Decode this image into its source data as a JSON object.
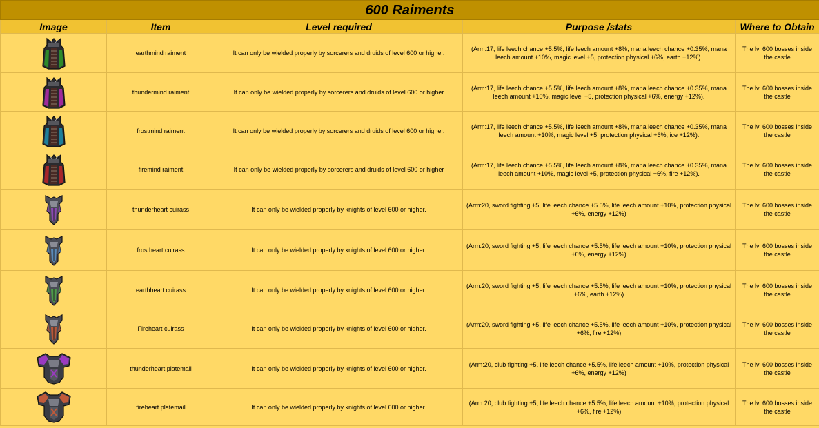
{
  "title": "600 Raiments",
  "headers": {
    "image": "Image",
    "item": "Item",
    "level": "Level required",
    "purpose": "Purpose /stats",
    "where": "Where to Obtain"
  },
  "rows": [
    {
      "icon": "earthmind-raiment-icon",
      "shape": "robe",
      "color": "#2f8a2a",
      "item": "earthmind raiment",
      "level": "It can only be wielded properly by sorcerers and druids of level 600 or higher.",
      "purpose": "(Arm:17, life leech chance +5.5%, life leech amount +8%, mana leech chance +0.35%, mana leech amount +10%, magic level +5, protection physical +6%, earth +12%).",
      "where": "The lvl 600 bosses inside the castle"
    },
    {
      "icon": "thundermind-raiment-icon",
      "shape": "robe",
      "color": "#a02a9a",
      "item": "thundermind raiment",
      "level": "It can only be wielded properly by sorcerers and druids of level 600 or higher",
      "purpose": "(Arm:17, life leech chance +5.5%, life leech amount +8%, mana leech chance +0.35%, mana leech amount +10%, magic level +5, protection physical +6%, energy +12%).",
      "where": "The lvl 600 bosses inside the castle"
    },
    {
      "icon": "frostmind-raiment-icon",
      "shape": "robe",
      "color": "#1f7f9a",
      "item": "frostmind raiment",
      "level": "It can only be wielded properly by sorcerers and druids of level 600 or higher.",
      "purpose": "(Arm:17, life leech chance +5.5%, life leech amount +8%, mana leech chance +0.35%, mana leech amount +10%, magic level +5, protection physical +6%, ice +12%).",
      "where": "The lvl 600 bosses inside the castle"
    },
    {
      "icon": "firemind-raiment-icon",
      "shape": "robe",
      "color": "#a8262a",
      "item": "firemind raiment",
      "level": "It can only be wielded properly by sorcerers and druids of level 600 or higher",
      "purpose": "(Arm:17, life leech chance +5.5%, life leech amount +8%, mana leech chance +0.35%, mana leech amount +10%, magic level +5, protection physical +6%, fire +12%).",
      "where": "The lvl 600 bosses inside the castle"
    },
    {
      "icon": "thunderheart-cuirass-icon",
      "shape": "cuirass",
      "color": "#8a4ab0",
      "item": "thunderheart cuirass",
      "level": "It can only be wielded properly by knights of level 600 or higher.",
      "purpose": "(Arm:20, sword fighting +5, life leech chance +5.5%, life leech amount +10%, protection physical +6%, energy +12%)",
      "where": "The lvl 600 bosses inside the castle"
    },
    {
      "icon": "frostheart-cuirass-icon",
      "shape": "cuirass",
      "color": "#5a8ab8",
      "item": "frostheart cuirass",
      "level": "It can only be wielded properly by knights of level 600 or higher.",
      "purpose": "(Arm:20, sword fighting +5, life leech chance +5.5%, life leech amount +10%, protection physical +6%, energy +12%)",
      "where": "The lvl 600 bosses inside the castle"
    },
    {
      "icon": "earthheart-cuirass-icon",
      "shape": "cuirass",
      "color": "#4e9a4a",
      "item": "earthheart cuirass",
      "level": "It can only be wielded properly by knights of level 600 or higher.",
      "purpose": "(Arm:20, sword fighting +5, life leech chance +5.5%, life leech amount +10%, protection physical +6%, earth +12%)",
      "where": "The lvl 600 bosses inside the castle"
    },
    {
      "icon": "fireheart-cuirass-icon",
      "shape": "cuirass",
      "color": "#b8583a",
      "item": "Fireheart cuirass",
      "level": "It can only be wielded properly by knights of level 600 or higher.",
      "purpose": "(Arm:20, sword fighting +5, life leech chance +5.5%, life leech amount +10%, protection physical +6%, fire +12%)",
      "where": "The lvl 600 bosses inside the castle"
    },
    {
      "icon": "thunderheart-platemail-icon",
      "shape": "plate",
      "color": "#9a3ac0",
      "item": "thunderheart platemail",
      "level": "It can only be wielded properly by knights of level 600 or higher.",
      "purpose": "(Arm:20, club fighting +5, life leech chance +5.5%, life leech amount +10%, protection physical +6%, energy +12%)",
      "where": "The lvl 600 bosses inside the castle"
    },
    {
      "icon": "fireheart-platemail-icon",
      "shape": "plate",
      "color": "#c05a3a",
      "item": "fireheart platemail",
      "level": "It can only be wielded properly by knights of level 600 or higher.",
      "purpose": "(Arm:20, club fighting +5, life leech chance +5.5%, life leech amount +10%, protection physical +6%, fire +12%)",
      "where": "The lvl 600 bosses inside the castle"
    }
  ]
}
